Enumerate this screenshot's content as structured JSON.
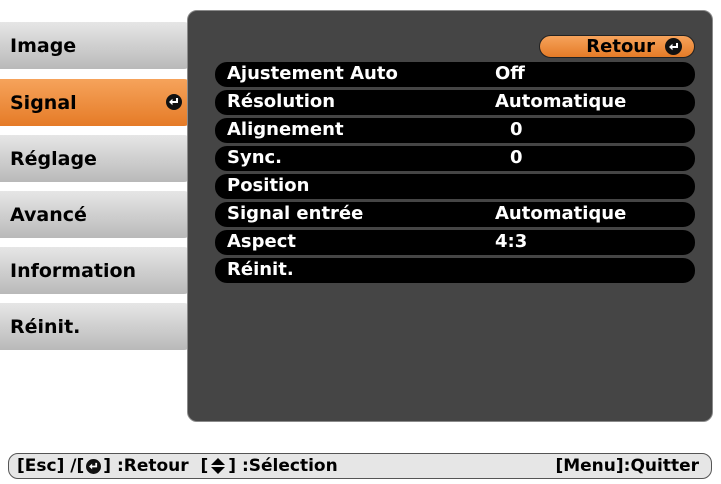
{
  "menu": {
    "items": [
      {
        "label": "Image"
      },
      {
        "label": "Signal"
      },
      {
        "label": "Réglage"
      },
      {
        "label": "Avancé"
      },
      {
        "label": "Information"
      },
      {
        "label": "Réinit."
      }
    ],
    "selected": "Signal"
  },
  "panel": {
    "back_label": "Retour",
    "rows": [
      {
        "label": "Ajustement Auto",
        "value": "Off"
      },
      {
        "label": "Résolution",
        "value": "Automatique"
      },
      {
        "label": "Alignement",
        "value": "0"
      },
      {
        "label": "Sync.",
        "value": "0"
      },
      {
        "label": "Position",
        "value": ""
      },
      {
        "label": "Signal entrée",
        "value": "Automatique"
      },
      {
        "label": "Aspect",
        "value": "4:3"
      },
      {
        "label": "Réinit.",
        "value": ""
      }
    ]
  },
  "bottom_bar": {
    "esc": "[Esc] /[",
    "retour": "] :Retour  [",
    "selection": "] :Sélection",
    "quit": "[Menu]:Quitter"
  },
  "colors": {
    "accent": "#e57b27",
    "panel": "#454545",
    "row": "#000000"
  }
}
